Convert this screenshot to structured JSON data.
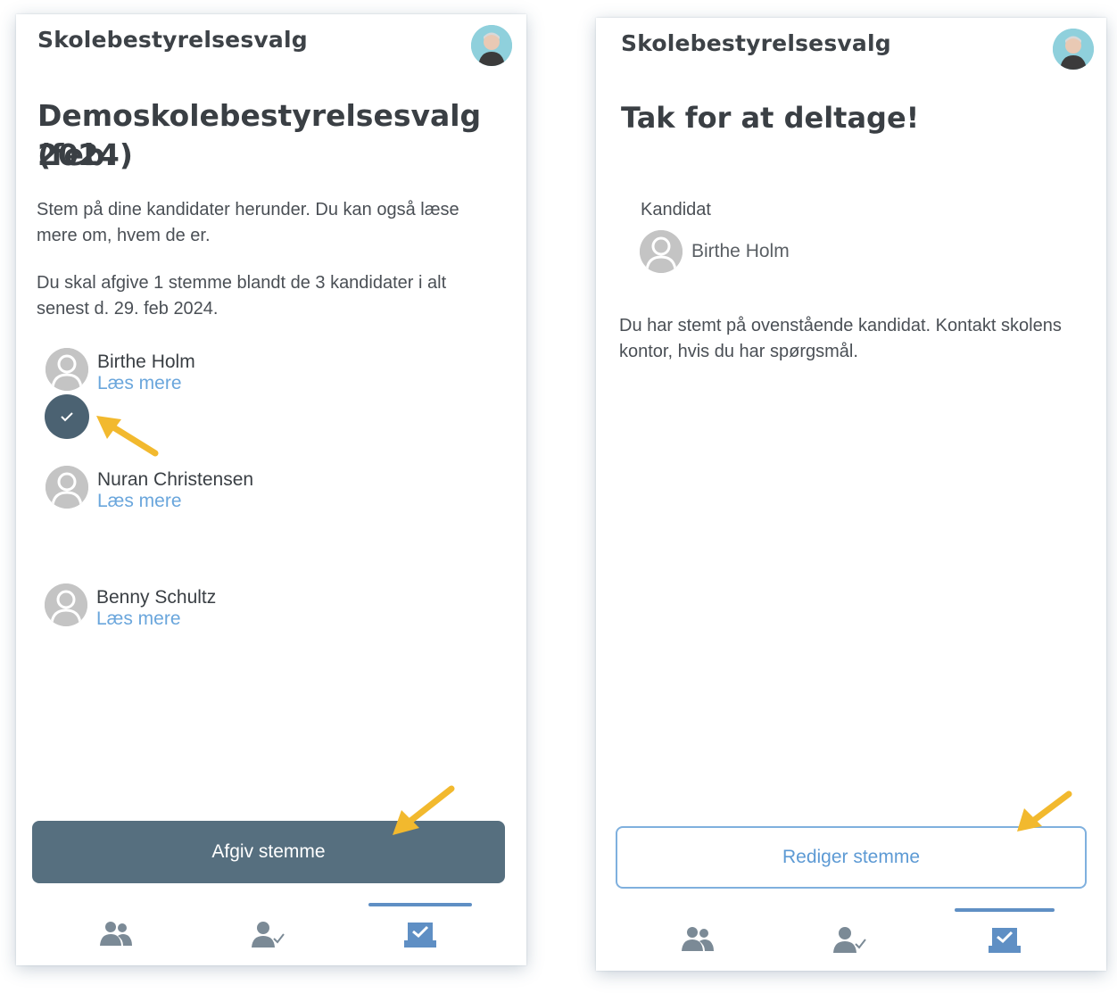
{
  "left_screen": {
    "app_title": "Skolebestyrelsesvalg",
    "heading_line1": "Demoskolebestyrelsesvalg (feb.",
    "heading_line2": "2024)",
    "intro_line1": "Stem på dine kandidater herunder. Du kan også læse",
    "intro_line2": "mere om, hvem de er.",
    "rule_line1": "Du skal afgive 1 stemme blandt de 3 kandidater i alt",
    "rule_line2": "senest d. 29. feb 2024.",
    "candidates": [
      {
        "name": "Birthe Holm",
        "link": "Læs mere"
      },
      {
        "name": "Nuran Christensen",
        "link": "Læs mere"
      },
      {
        "name": "Benny Schultz",
        "link": "Læs mere"
      }
    ],
    "submit_label": "Afgiv stemme"
  },
  "right_screen": {
    "app_title": "Skolebestyrelsesvalg",
    "heading": "Tak for at deltage!",
    "candidate_label": "Kandidat",
    "voted_candidate": "Birthe Holm",
    "info_line1": "Du har stemt på ovenstående kandidat. Kontakt skolens",
    "info_line2": "kontor, hvis du har spørgsmål.",
    "edit_label": "Rediger stemme"
  },
  "nav": {
    "icons": [
      "people-icon",
      "person-check-icon",
      "ballot-box-icon"
    ],
    "active_index": 2
  },
  "colors": {
    "primary": "#566f7f",
    "link": "#6aa6dc",
    "arrow": "#f2b92e",
    "nav_icon": "#7b8a96",
    "active_nav": "#5f8fc4"
  }
}
